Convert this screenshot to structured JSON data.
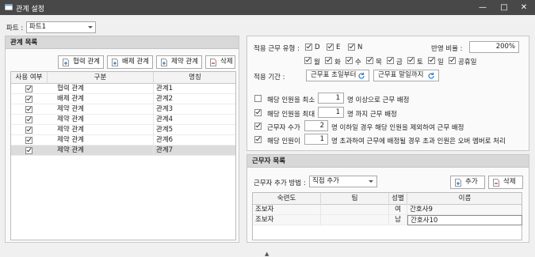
{
  "window": {
    "title": "관계 설정",
    "min_icon": "minimize-icon",
    "max_icon": "maximize-icon",
    "close_icon": "close-icon"
  },
  "part": {
    "label": "파트 :",
    "value": "파트1"
  },
  "relation_panel": {
    "title": "관계 목록",
    "buttons": {
      "cooperation": "협력 관계",
      "exclusion": "배제 관계",
      "restriction": "제약 관계",
      "delete": "삭제"
    },
    "columns": {
      "use": "사용 여부",
      "type": "구분",
      "name": "명칭"
    },
    "rows": [
      {
        "use": true,
        "type": "협력 관계",
        "name": "관계1"
      },
      {
        "use": true,
        "type": "배제 관계",
        "name": "관계2"
      },
      {
        "use": true,
        "type": "제약 관계",
        "name": "관계3"
      },
      {
        "use": true,
        "type": "제약 관계",
        "name": "관계4"
      },
      {
        "use": true,
        "type": "제약 관계",
        "name": "관계5"
      },
      {
        "use": true,
        "type": "제약 관계",
        "name": "관계6"
      },
      {
        "use": true,
        "type": "제약 관계",
        "name": "관계7"
      }
    ]
  },
  "settings": {
    "shift_type_label": "적용 근무 유형 :",
    "shift_types": [
      {
        "label": "D",
        "checked": true
      },
      {
        "label": "E",
        "checked": true
      },
      {
        "label": "N",
        "checked": true
      }
    ],
    "ratio_label": "반영 비율 :",
    "ratio_value": "200%",
    "days": [
      {
        "label": "월",
        "checked": true
      },
      {
        "label": "화",
        "checked": true
      },
      {
        "label": "수",
        "checked": true
      },
      {
        "label": "목",
        "checked": true
      },
      {
        "label": "금",
        "checked": true
      },
      {
        "label": "토",
        "checked": true
      },
      {
        "label": "일",
        "checked": true
      },
      {
        "label": "공휴일",
        "checked": true
      }
    ],
    "period_label": "적용 기간 :",
    "period_start": "근무표 초일부터",
    "period_end": "근무표 말일까지",
    "rules": [
      {
        "checked": false,
        "prefix": "해당 인원을 최소",
        "value": "1",
        "suffix": "명 이상으로 근무 배정"
      },
      {
        "checked": true,
        "prefix": "해당 인원을 최대",
        "value": "1",
        "suffix": "명 까지 근무 배정"
      },
      {
        "checked": true,
        "prefix": "근무자 수가",
        "value": "2",
        "suffix": "명 이하일 경우 해당 인원을 제외하여 근무 배정"
      },
      {
        "checked": true,
        "prefix": "해당 인원이",
        "value": "1",
        "suffix": "명 초과하여 근무에 배정될 경우 초과 인원은 오버 멤버로 처리"
      }
    ]
  },
  "worker_panel": {
    "title": "근무자 목록",
    "method_label": "근무자 추가 방법 :",
    "method_value": "직접 추가",
    "add": "추가",
    "delete": "삭제",
    "columns": {
      "skill": "숙련도",
      "team": "팀",
      "gender": "성별",
      "name": "이름"
    },
    "rows": [
      {
        "skill": "조보자",
        "team": "",
        "gender": "여",
        "name": "간호사9"
      },
      {
        "skill": "조보자",
        "team": "",
        "gender": "남",
        "name": "간호사10"
      }
    ]
  }
}
